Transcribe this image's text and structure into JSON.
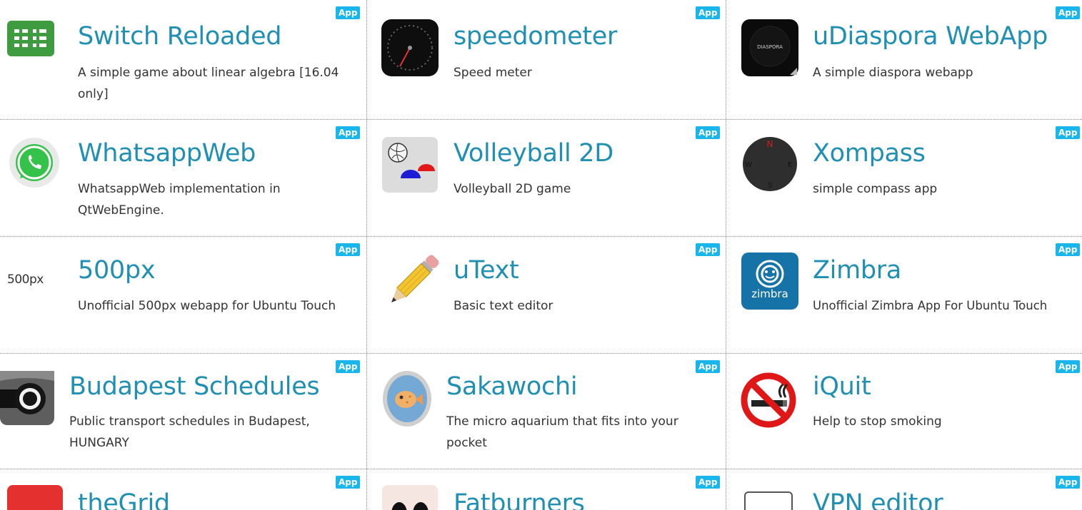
{
  "badge_label": "App",
  "colors": {
    "title": "#1f8fb4",
    "badge": "#19b6ee",
    "text": "#333333",
    "divider": "#8a8a8a"
  },
  "apps": [
    {
      "title": "Switch Reloaded",
      "description": "A simple game about linear algebra [16.04 only]",
      "icon": "switch-reloaded-grid-icon"
    },
    {
      "title": "speedometer",
      "description": "Speed meter",
      "icon": "speedometer-icon"
    },
    {
      "title": "uDiaspora WebApp",
      "description": "A simple diaspora webapp",
      "icon": "diaspora-icon",
      "icon_text": "DIASPORA"
    },
    {
      "title": "WhatsappWeb",
      "description": "WhatsappWeb implementation in QtWebEngine.",
      "icon": "whatsapp-icon"
    },
    {
      "title": "Volleyball 2D",
      "description": "Volleyball 2D game",
      "icon": "volleyball-icon"
    },
    {
      "title": "Xompass",
      "description": "simple compass app",
      "icon": "compass-icon",
      "icon_letters": [
        "N",
        "W",
        "E",
        "S"
      ]
    },
    {
      "title": "500px",
      "description": "Unofficial 500px webapp for Ubuntu Touch",
      "icon": "500px-logo-icon",
      "icon_text": "500px"
    },
    {
      "title": "uText",
      "description": "Basic text editor",
      "icon": "pencil-icon"
    },
    {
      "title": "Zimbra",
      "description": "Unofficial Zimbra App For Ubuntu Touch",
      "icon": "zimbra-icon",
      "icon_text": "zimbra"
    },
    {
      "title": "Budapest Schedules",
      "description": "Public transport schedules in Budapest, HUNGARY",
      "icon": "camera-lens-icon"
    },
    {
      "title": "Sakawochi",
      "description": "The micro aquarium that fits into your pocket",
      "icon": "fish-icon"
    },
    {
      "title": "iQuit",
      "description": "Help to stop smoking",
      "icon": "no-smoking-icon"
    },
    {
      "title": "theGrid",
      "description": "",
      "icon": "thegrid-icon"
    },
    {
      "title": "Fatburners",
      "description": "",
      "icon": "fatburners-icon"
    },
    {
      "title": "VPN editor",
      "description": "",
      "icon": "vpn-editor-icon"
    }
  ]
}
